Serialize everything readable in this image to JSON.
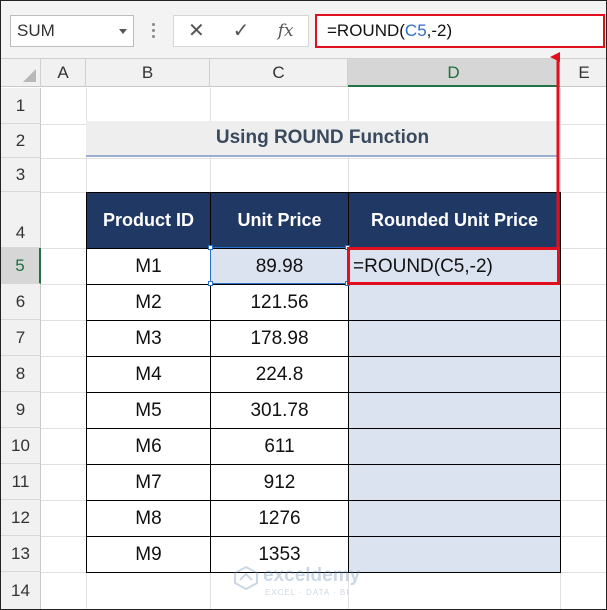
{
  "name_box": {
    "value": "SUM"
  },
  "formula_bar": {
    "cancel_glyph": "✕",
    "enter_glyph": "✓",
    "fx_glyph": "fx",
    "formula_prefix": "=ROUND(",
    "formula_ref": "C5",
    "formula_suffix": ",-2)"
  },
  "column_headers": [
    "A",
    "B",
    "C",
    "D",
    "E"
  ],
  "row_headers": [
    "1",
    "2",
    "3",
    "4",
    "5",
    "6",
    "7",
    "8",
    "9",
    "10",
    "11",
    "12",
    "13",
    "14"
  ],
  "active_row": "5",
  "title": "Using ROUND Function",
  "table": {
    "headers": [
      "Product ID",
      "Unit Price",
      "Rounded Unit Price"
    ],
    "rows": [
      {
        "id": "M1",
        "price": "89.98",
        "rounded": "=ROUND(C5,-2)"
      },
      {
        "id": "M2",
        "price": "121.56",
        "rounded": ""
      },
      {
        "id": "M3",
        "price": "178.98",
        "rounded": ""
      },
      {
        "id": "M4",
        "price": "224.8",
        "rounded": ""
      },
      {
        "id": "M5",
        "price": "301.78",
        "rounded": ""
      },
      {
        "id": "M6",
        "price": "611",
        "rounded": ""
      },
      {
        "id": "M7",
        "price": "912",
        "rounded": ""
      },
      {
        "id": "M8",
        "price": "1276",
        "rounded": ""
      },
      {
        "id": "M9",
        "price": "1353",
        "rounded": ""
      }
    ]
  },
  "watermark": {
    "name": "exceldemy",
    "tagline": "EXCEL · DATA · BI"
  },
  "colors": {
    "header_fill": "#1f3864",
    "highlight_fill": "#dce3f0",
    "annotation_red": "#e1101e",
    "reference_blue": "#2f6fc6"
  }
}
